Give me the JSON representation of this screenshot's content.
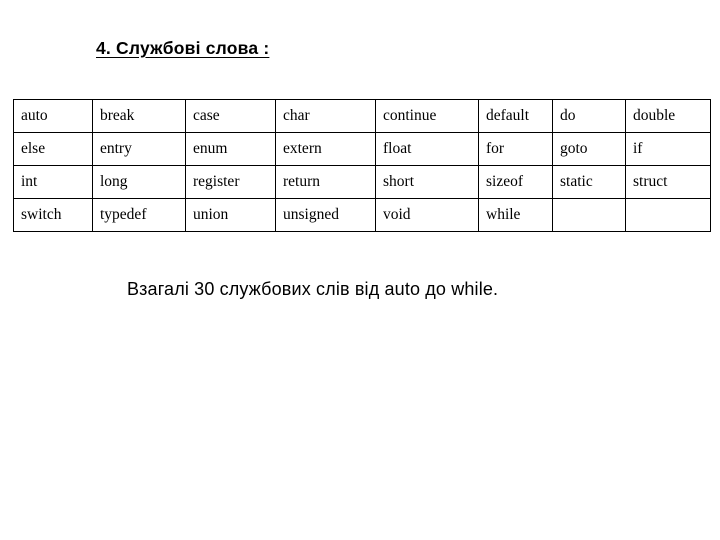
{
  "slide": {
    "title": "4. Службові слова :",
    "caption": "Взагалі 30 службових слів від auto до while.",
    "background_color": "#ffffff",
    "text_color": "#000000",
    "border_color": "#000000"
  },
  "keyword_table": {
    "columns": 8,
    "rows": 4,
    "cells": [
      [
        "auto",
        "break",
        "case",
        "char",
        "continue",
        "default",
        "do",
        "double"
      ],
      [
        "else",
        "entry",
        "enum",
        "extern",
        "float",
        "for",
        "goto",
        "if"
      ],
      [
        "int",
        "long",
        "register",
        "return",
        "short",
        "sizeof",
        "static",
        "struct"
      ],
      [
        "switch",
        "typedef",
        "union",
        "unsigned",
        "void",
        "while",
        "",
        ""
      ]
    ]
  }
}
